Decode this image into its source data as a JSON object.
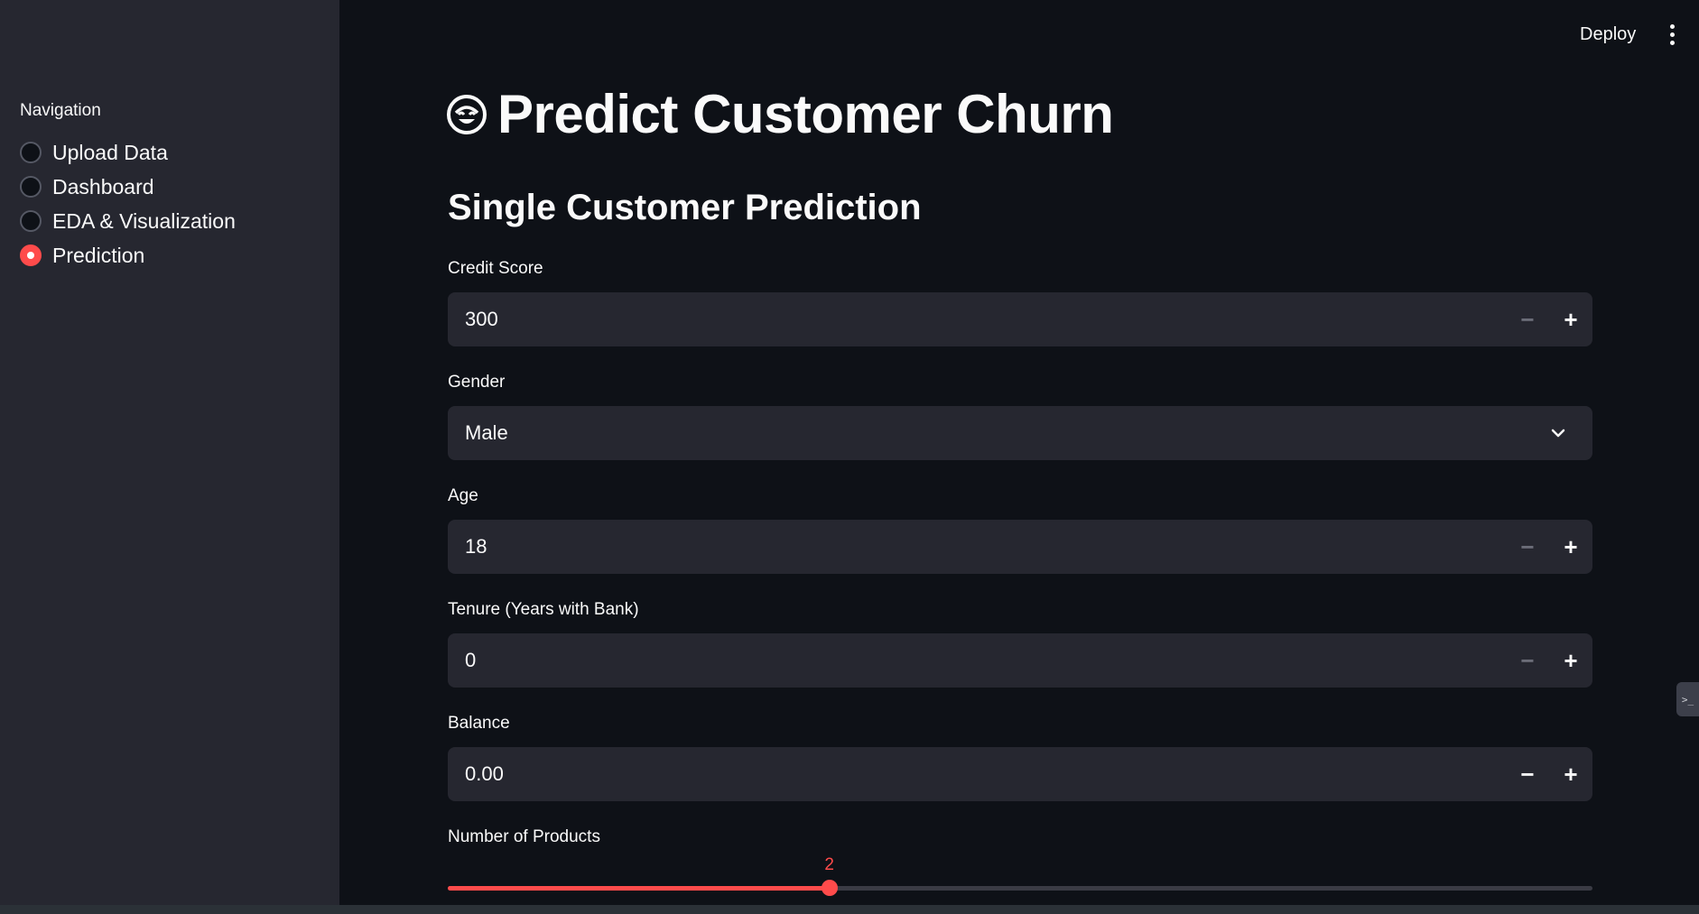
{
  "header": {
    "deploy_label": "Deploy",
    "menu_icon": "kebab-menu-icon"
  },
  "sidebar": {
    "title": "Navigation",
    "items": [
      {
        "label": "Upload Data",
        "selected": false
      },
      {
        "label": "Dashboard",
        "selected": false
      },
      {
        "label": "EDA & Visualization",
        "selected": false
      },
      {
        "label": "Prediction",
        "selected": true
      }
    ]
  },
  "main": {
    "title": "Predict Customer Churn",
    "title_icon": "smiling-face-icon",
    "subheader": "Single Customer Prediction",
    "fields": {
      "credit_score": {
        "label": "Credit Score",
        "value": "300"
      },
      "gender": {
        "label": "Gender",
        "value": "Male"
      },
      "age": {
        "label": "Age",
        "value": "18"
      },
      "tenure": {
        "label": "Tenure (Years with Bank)",
        "value": "0"
      },
      "balance": {
        "label": "Balance",
        "value": "0.00"
      },
      "num_products": {
        "label": "Number of Products",
        "value": "2",
        "min": 1,
        "max": 4
      }
    }
  },
  "side_tab": {
    "icon": "terminal-icon",
    "text": ">_"
  },
  "colors": {
    "accent": "#ff4b4b",
    "background": "#0e1117",
    "sidebar": "#262730",
    "input": "#262730"
  }
}
